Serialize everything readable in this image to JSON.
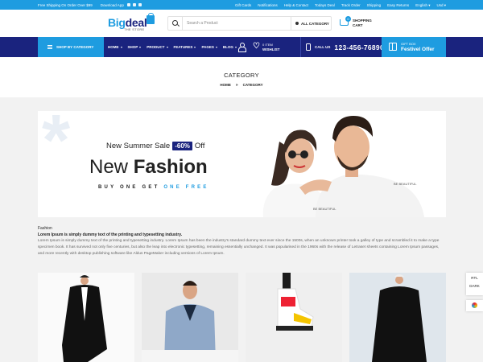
{
  "topbar": {
    "left": [
      "Free Shipping On Order Over $99",
      "Download App"
    ],
    "right": [
      "Gift Cards",
      "Notifications",
      "Help & Contact",
      "Todays Deal",
      "Track Order",
      "Shipping",
      "Easy Returns",
      "English",
      "Usd"
    ]
  },
  "logo": {
    "big1": "Big",
    "big2": "deal",
    "sub": "THE STORE"
  },
  "search": {
    "placeholder": "Search a Product",
    "category": "ALL CATEGORY"
  },
  "cart": {
    "count": "0",
    "line1": "SHOPPING",
    "line2": "CART"
  },
  "nav": {
    "shop_by_category": "SHOP BY CATEGORY",
    "items": [
      "HOME",
      "SHOP",
      "PRODUCT",
      "FEATURES",
      "PAGES",
      "BLOG"
    ],
    "wishlist_count": "0 ITEM",
    "wishlist_label": "WISHLIST",
    "call_label": "CALL US",
    "phone": "123-456-76890",
    "gift_small": "GIFT BOX",
    "gift_big": "Festivel Offer"
  },
  "page": {
    "title": "CATEGORY",
    "breadcrumb": [
      "HOME",
      "CATEGORY"
    ]
  },
  "banner": {
    "sale_text": "New Summer Sale",
    "sale_pct": "-60%",
    "sale_off": "Off",
    "headline_1": "New",
    "headline_2": "Fashion",
    "bogo_1": "BUY ONE GET",
    "bogo_2": "ONE FREE"
  },
  "intro": {
    "title": "Fashion",
    "subtitle": "Lorem Ipsum is simply dummy text of the printing and typesetting industry.",
    "body": "Lorem Ipsum is simply dummy text of the printing and typesetting industry. Lorem Ipsum has been the industry's standard dummy text ever since the 1500s, when an unknown printer took a galley of type and scrambled it to make a type specimen book. It has survived not only five centuries, but also the leap into electronic typesetting, remaining essentially unchanged. It was popularised in the 1960s with the release of Letraset sheets containing Lorem Ipsum passages, and more recently with desktop publishing software like Aldus PageMaker including versions of Lorem Ipsum."
  },
  "couple_tshirt_text": "BE BEAUTIFUL",
  "sidebar_tools": [
    "RTL",
    "DARK"
  ],
  "colors": {
    "accent": "#1e9ce0",
    "navy": "#1a237e",
    "bg": "#f2f2f2"
  }
}
